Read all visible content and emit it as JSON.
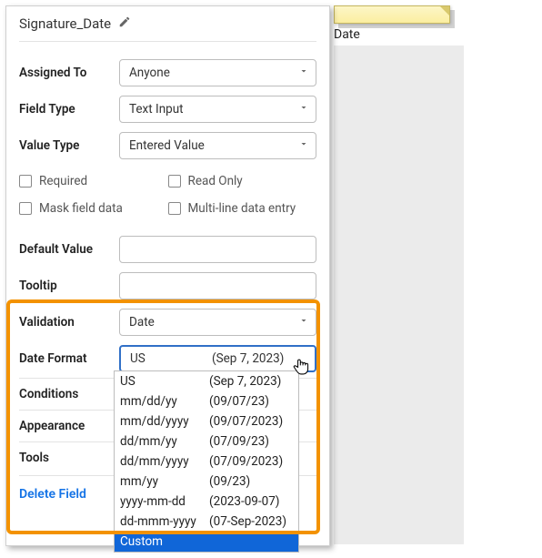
{
  "title": "Signature_Date",
  "rows": {
    "assigned_to": {
      "label": "Assigned To",
      "value": "Anyone"
    },
    "field_type": {
      "label": "Field Type",
      "value": "Text Input"
    },
    "value_type": {
      "label": "Value Type",
      "value": "Entered Value"
    },
    "default_value": {
      "label": "Default Value",
      "value": ""
    },
    "tooltip": {
      "label": "Tooltip",
      "value": ""
    },
    "validation": {
      "label": "Validation",
      "value": "Date"
    },
    "date_format": {
      "label": "Date Format"
    }
  },
  "checkboxes": {
    "required": "Required",
    "read_only": "Read Only",
    "mask": "Mask field data",
    "multiline": "Multi-line data entry"
  },
  "date_format_selected": {
    "format": "US",
    "example": "(Sep 7, 2023)"
  },
  "date_format_options": [
    {
      "format": "US",
      "example": "(Sep 7, 2023)"
    },
    {
      "format": "mm/dd/yy",
      "example": "(09/07/23)"
    },
    {
      "format": "mm/dd/yyyy",
      "example": "(09/07/2023)"
    },
    {
      "format": "dd/mm/yy",
      "example": "(07/09/23)"
    },
    {
      "format": "dd/mm/yyyy",
      "example": "(07/09/2023)"
    },
    {
      "format": "mm/yy",
      "example": "(09/23)"
    },
    {
      "format": "yyyy-mm-dd",
      "example": "(2023-09-07)"
    },
    {
      "format": "dd-mmm-yyyy",
      "example": "(07-Sep-2023)"
    },
    {
      "format": "Custom",
      "example": ""
    }
  ],
  "sections": {
    "conditions": "Conditions",
    "appearance": "Appearance",
    "tools": "Tools"
  },
  "delete_label": "Delete Field",
  "sticky_label": "Date",
  "highlight_color": "#f39200"
}
